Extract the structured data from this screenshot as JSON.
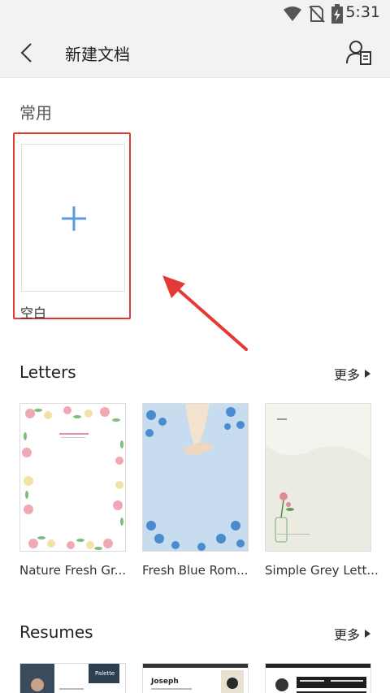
{
  "status": {
    "time": "5:31"
  },
  "appbar": {
    "title": "新建文档"
  },
  "common": {
    "label": "常用",
    "blank_label": "空白"
  },
  "letters": {
    "title": "Letters",
    "more": "更多",
    "templates": [
      {
        "name": "Nature Fresh Gr..."
      },
      {
        "name": "Fresh Blue Rom..."
      },
      {
        "name": "Simple Grey Lett..."
      }
    ]
  },
  "resumes": {
    "title": "Resumes",
    "more": "更多",
    "preview_text": {
      "palette": "Palette",
      "joseph": "Joseph"
    }
  },
  "colors": {
    "annotation": "#e53935",
    "plus": "#5a9be6"
  }
}
